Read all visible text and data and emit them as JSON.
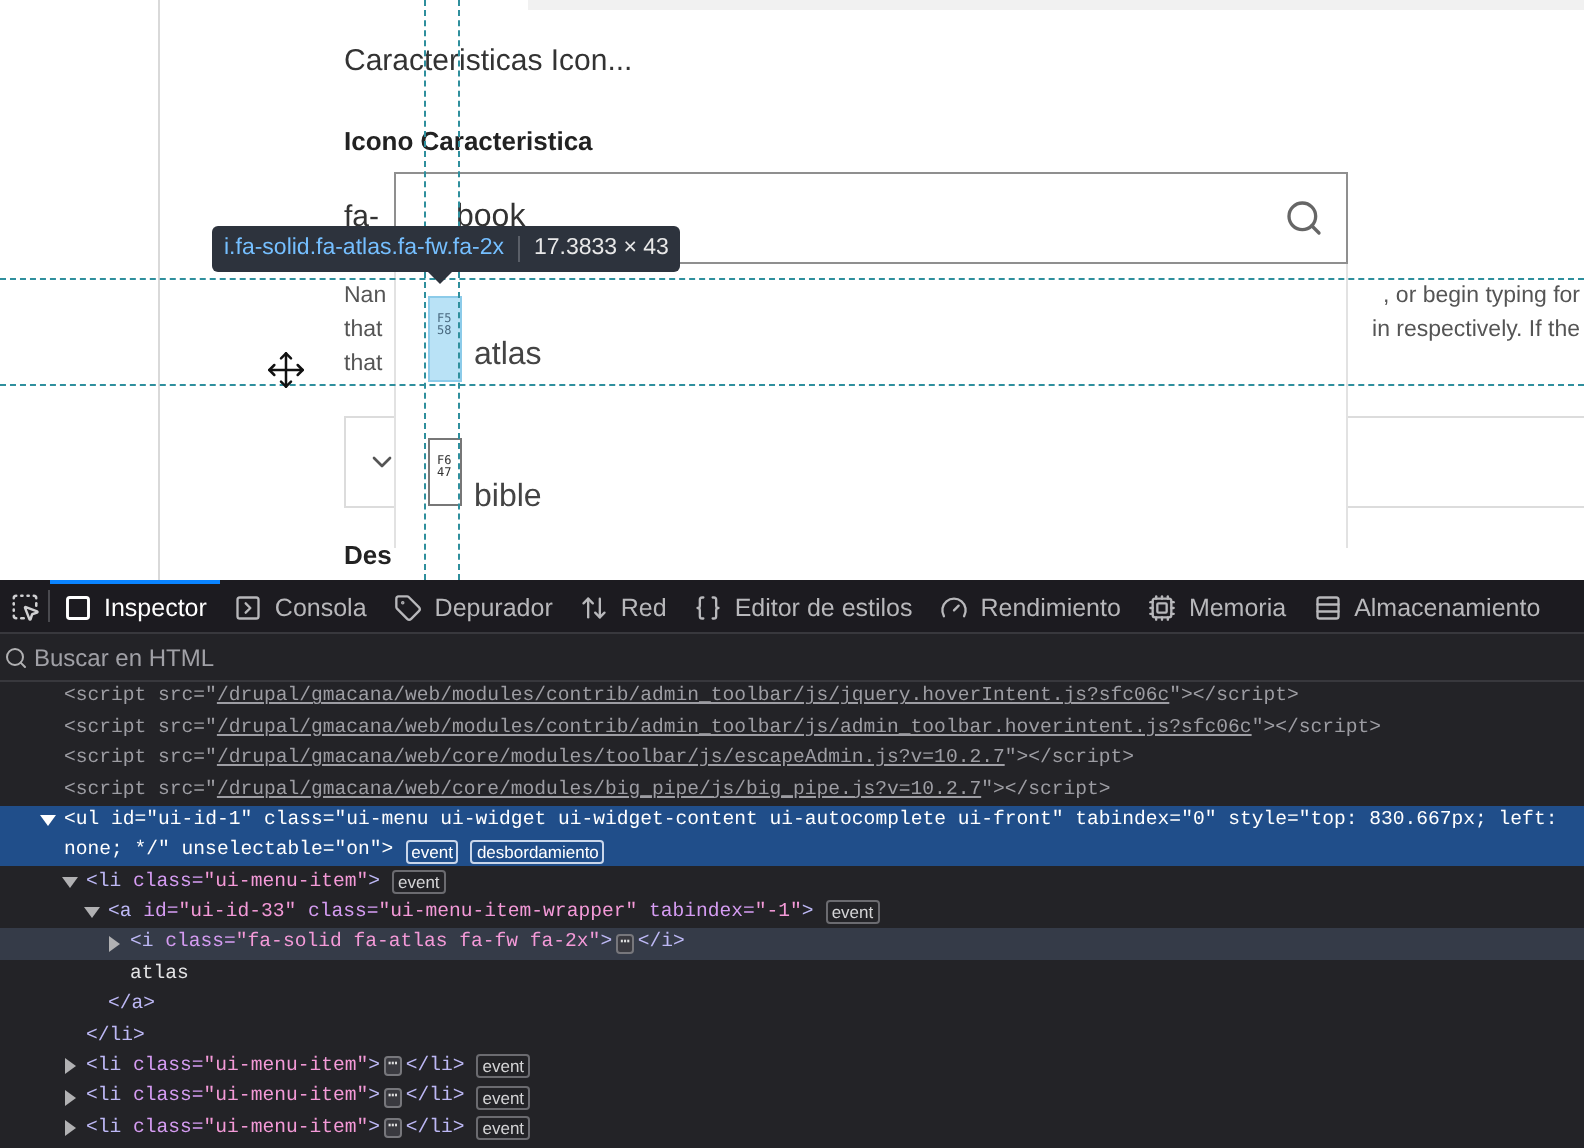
{
  "page": {
    "heading": "Caracteristicas Icon...",
    "field_label": "Icono Caracteristica",
    "field_prefix": "fa-",
    "help_lines": [
      {
        "left": "Nan",
        "right": ", or begin typing for"
      },
      {
        "left": "that",
        "right": "in respectively. If the"
      },
      {
        "left": "that"
      }
    ],
    "section_heading": "Des"
  },
  "autocomplete": {
    "value": "book",
    "items": [
      {
        "label": "atlas",
        "glyph": "F558",
        "highlighted": true
      },
      {
        "label": "bible",
        "glyph": "F647",
        "highlighted": false
      }
    ]
  },
  "inspector_tooltip": {
    "selector": "i.fa-solid.fa-atlas.fa-fw.fa-2x",
    "size": "17.3833 × 43"
  },
  "devtools": {
    "tabs": [
      {
        "label": "Inspector",
        "selected": true
      },
      {
        "label": "Consola",
        "selected": false
      },
      {
        "label": "Depurador",
        "selected": false
      },
      {
        "label": "Red",
        "selected": false
      },
      {
        "label": "Editor de estilos",
        "selected": false
      },
      {
        "label": "Rendimiento",
        "selected": false
      },
      {
        "label": "Memoria",
        "selected": false
      },
      {
        "label": "Almacenamiento",
        "selected": false
      }
    ],
    "search": {
      "placeholder": "Buscar en HTML"
    },
    "tree": [
      {
        "selected": false,
        "highlighted": false,
        "lines": [
          [
            {
              "kind": "punct",
              "text": "<script src=\""
            },
            {
              "kind": "link",
              "text": "/drupal/gmacana/web/modules/contrib/admin_toolbar/js/jquery.hoverIntent.js?sfc06c"
            },
            {
              "kind": "punct",
              "text": "\"></script>"
            }
          ]
        ]
      },
      {
        "selected": false,
        "highlighted": false,
        "lines": [
          [
            {
              "kind": "punct",
              "text": "<script src=\""
            },
            {
              "kind": "link",
              "text": "/drupal/gmacana/web/modules/contrib/admin_toolbar/js/admin_toolbar.hoverintent.js?sfc06c"
            },
            {
              "kind": "punct",
              "text": "\"></script>"
            }
          ]
        ]
      },
      {
        "selected": false,
        "highlighted": false,
        "lines": [
          [
            {
              "kind": "punct",
              "text": "<script src=\""
            },
            {
              "kind": "link",
              "text": "/drupal/gmacana/web/core/modules/toolbar/js/escapeAdmin.js?v=10.2.7"
            },
            {
              "kind": "punct",
              "text": "\"></script>"
            }
          ]
        ]
      },
      {
        "selected": false,
        "highlighted": false,
        "lines": [
          [
            {
              "kind": "punct",
              "text": "<script src=\""
            },
            {
              "kind": "link",
              "text": "/drupal/gmacana/web/core/modules/big_pipe/js/big_pipe.js?v=10.2.7"
            },
            {
              "kind": "punct",
              "text": "\"></script>"
            }
          ]
        ]
      },
      {
        "expanded": true,
        "selected": true,
        "highlighted": false,
        "lines": [
          [
            {
              "kind": "tag",
              "text": "<ul"
            },
            {
              "kind": "attr",
              "text": " id="
            },
            {
              "kind": "value",
              "text": "\"ui-id-1\""
            },
            {
              "kind": "attr",
              "text": " class="
            },
            {
              "kind": "value",
              "text": "\"ui-menu ui-widget ui-widget-content ui-autocomplete ui-front\""
            },
            {
              "kind": "attr",
              "text": " tabindex="
            },
            {
              "kind": "value",
              "text": "\"0\""
            },
            {
              "kind": "attr",
              "text": " style="
            },
            {
              "kind": "value",
              "text": "\"top: 830.667px; left:"
            }
          ],
          [
            {
              "kind": "value",
              "text": "none; */\""
            },
            {
              "kind": "attr",
              "text": " unselectable="
            },
            {
              "kind": "value",
              "text": "\"on\""
            },
            {
              "kind": "tag",
              "text": ">"
            },
            {
              "kind": "badge",
              "text": "event"
            },
            {
              "kind": "badge",
              "text": "desbordamiento"
            }
          ]
        ],
        "children": [
          {
            "expanded": true,
            "selected": false,
            "highlighted": false,
            "lines": [
              [
                {
                  "kind": "tag",
                  "text": "<li"
                },
                {
                  "kind": "attr",
                  "text": " class="
                },
                {
                  "kind": "value",
                  "text": "\"ui-menu-item\""
                },
                {
                  "kind": "tag",
                  "text": ">"
                },
                {
                  "kind": "badge",
                  "text": "event"
                }
              ]
            ],
            "children": [
              {
                "expanded": true,
                "selected": false,
                "highlighted": false,
                "lines": [
                  [
                    {
                      "kind": "tag",
                      "text": "<a"
                    },
                    {
                      "kind": "attr",
                      "text": " id="
                    },
                    {
                      "kind": "value",
                      "text": "\"ui-id-33\""
                    },
                    {
                      "kind": "attr",
                      "text": " class="
                    },
                    {
                      "kind": "value",
                      "text": "\"ui-menu-item-wrapper\""
                    },
                    {
                      "kind": "attr",
                      "text": " tabindex="
                    },
                    {
                      "kind": "value",
                      "text": "\"-1\""
                    },
                    {
                      "kind": "tag",
                      "text": ">"
                    },
                    {
                      "kind": "badge",
                      "text": "event"
                    }
                  ]
                ],
                "children": [
                  {
                    "expanded": false,
                    "selected": false,
                    "highlighted": true,
                    "lines": [
                      [
                        {
                          "kind": "tag",
                          "text": "<i"
                        },
                        {
                          "kind": "attr",
                          "text": " class="
                        },
                        {
                          "kind": "value",
                          "text": "\"fa-solid fa-atlas fa-fw fa-2x\""
                        },
                        {
                          "kind": "tag",
                          "text": ">"
                        },
                        {
                          "kind": "more",
                          "text": "⋯"
                        },
                        {
                          "kind": "tag",
                          "text": "</i>"
                        }
                      ]
                    ]
                  },
                  {
                    "selected": false,
                    "highlighted": false,
                    "lines": [
                      [
                        {
                          "kind": "text",
                          "text": "atlas"
                        }
                      ]
                    ]
                  }
                ],
                "closing": [
                  {
                    "kind": "tag",
                    "text": "</a>"
                  }
                ]
              }
            ],
            "closing": [
              {
                "kind": "tag",
                "text": "</li>"
              }
            ]
          },
          {
            "expanded": false,
            "selected": false,
            "highlighted": false,
            "lines": [
              [
                {
                  "kind": "tag",
                  "text": "<li"
                },
                {
                  "kind": "attr",
                  "text": " class="
                },
                {
                  "kind": "value",
                  "text": "\"ui-menu-item\""
                },
                {
                  "kind": "tag",
                  "text": ">"
                },
                {
                  "kind": "more",
                  "text": "⋯"
                },
                {
                  "kind": "tag",
                  "text": "</li>"
                },
                {
                  "kind": "badge",
                  "text": "event"
                }
              ]
            ]
          },
          {
            "expanded": false,
            "selected": false,
            "highlighted": false,
            "lines": [
              [
                {
                  "kind": "tag",
                  "text": "<li"
                },
                {
                  "kind": "attr",
                  "text": " class="
                },
                {
                  "kind": "value",
                  "text": "\"ui-menu-item\""
                },
                {
                  "kind": "tag",
                  "text": ">"
                },
                {
                  "kind": "more",
                  "text": "⋯"
                },
                {
                  "kind": "tag",
                  "text": "</li>"
                },
                {
                  "kind": "badge",
                  "text": "event"
                }
              ]
            ]
          },
          {
            "expanded": false,
            "selected": false,
            "highlighted": false,
            "lines": [
              [
                {
                  "kind": "tag",
                  "text": "<li"
                },
                {
                  "kind": "attr",
                  "text": " class="
                },
                {
                  "kind": "value",
                  "text": "\"ui-menu-item\""
                },
                {
                  "kind": "tag",
                  "text": ">"
                },
                {
                  "kind": "more",
                  "text": "⋯"
                },
                {
                  "kind": "tag",
                  "text": "</li>"
                },
                {
                  "kind": "badge",
                  "text": "event"
                }
              ]
            ]
          }
        ]
      }
    ]
  }
}
